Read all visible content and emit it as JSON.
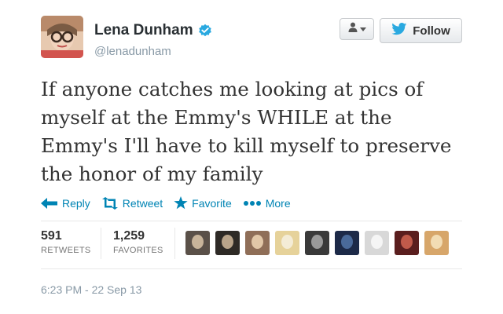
{
  "header": {
    "name": "Lena Dunham",
    "username": "@lenadunham",
    "follow_label": "Follow",
    "user_dropdown_icon": "user-icon",
    "verified_icon": "verified-badge-icon"
  },
  "tweet": {
    "text_lines": [
      "If anyone catches me looking at pics of",
      "myself at the Emmy's WHILE at the",
      "Emmy's I'll have to kill myself to preserve",
      "the honor of my family"
    ]
  },
  "actions": {
    "reply": "Reply",
    "retweet": "Retweet",
    "favorite": "Favorite",
    "more": "More"
  },
  "stats": {
    "retweets_count": "591",
    "retweets_label": "RETWEETS",
    "favorites_count": "1,259",
    "favorites_label": "FAVORITES"
  },
  "favoriters": [
    {
      "name": "favoriter-1",
      "colors": [
        "#5a5048",
        "#c8b49a"
      ]
    },
    {
      "name": "favoriter-2",
      "colors": [
        "#2e2a26",
        "#b9a48a"
      ]
    },
    {
      "name": "favoriter-3",
      "colors": [
        "#8f6e58",
        "#e2c7a8"
      ]
    },
    {
      "name": "favoriter-4",
      "colors": [
        "#e6d29a",
        "#f4ecd6"
      ]
    },
    {
      "name": "favoriter-5",
      "colors": [
        "#3a3a3a",
        "#9a9a9a"
      ]
    },
    {
      "name": "favoriter-6",
      "colors": [
        "#1d2a48",
        "#4a6a9a"
      ]
    },
    {
      "name": "favoriter-7",
      "colors": [
        "#d8d8d8",
        "#f5f5f5"
      ]
    },
    {
      "name": "favoriter-8",
      "colors": [
        "#5a1e1e",
        "#c05a4a"
      ]
    },
    {
      "name": "favoriter-9",
      "colors": [
        "#d7a66a",
        "#f2dcb4"
      ]
    }
  ],
  "timestamp": "6:23 PM - 22 Sep 13",
  "colors": {
    "link": "#0084b4",
    "twitter_blue": "#2aa9e0",
    "muted": "#8899a6"
  }
}
